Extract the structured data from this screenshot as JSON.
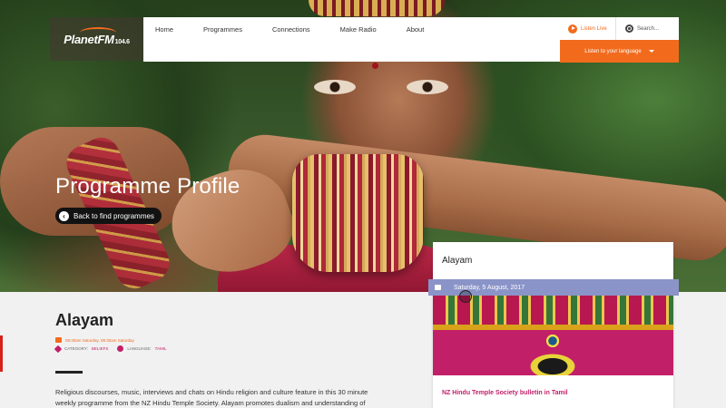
{
  "header": {
    "logo": {
      "name": "Planet",
      "fm": "FM",
      "freq": "104.6"
    },
    "nav": [
      "Home",
      "Programmes",
      "Connections",
      "Make Radio",
      "About"
    ],
    "listen_live": "Listen Live",
    "search_placeholder": "Search...",
    "language_button": "Listen to your language"
  },
  "hero": {
    "title": "Programme Profile",
    "back_link": "Back to find programmes"
  },
  "programme": {
    "title": "Alayam",
    "schedule": "08:30am Saturday, 08:30am Saturday",
    "category_label": "CATEGORY:",
    "category_value": "BELIEFS",
    "language_label": "LANGUAGE:",
    "language_value": "TAMIL",
    "description": "Religious discourses, music, interviews and chats on Hindu religion and culture feature in this 30 minute weekly programme from the NZ Hindu Temple Society. Alayam promotes dualism and understanding of"
  },
  "episode": {
    "title": "Alayam",
    "date": "Saturday, 5 August, 2017",
    "link": "NZ Hindu Temple Society bulletin in Tamil"
  },
  "colors": {
    "accent_orange": "#f26b1d",
    "accent_pink": "#c21f69",
    "date_bar": "#8b94c8"
  }
}
